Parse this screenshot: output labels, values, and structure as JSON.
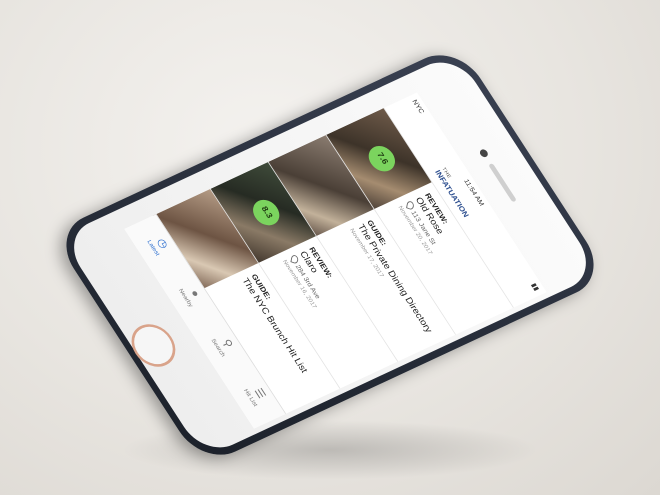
{
  "status": {
    "carrier": "NYC",
    "time": "11:54 AM",
    "battery": ""
  },
  "appbar": {
    "logo_line1": "THE",
    "logo_line2": "INFATUATION"
  },
  "feed": [
    {
      "kind": "REVIEW:",
      "title": "Old Rose",
      "address": "113 Jane St",
      "score": "7.6",
      "date": "November 20, 2017"
    },
    {
      "kind": "GUIDE:",
      "title": "The Private Dining Directory",
      "address": "",
      "score": "",
      "date": "November 17, 2017"
    },
    {
      "kind": "REVIEW:",
      "title": "Claro",
      "address": "284 3rd Ave",
      "score": "8.3",
      "date": "November 16, 2017"
    },
    {
      "kind": "GUIDE:",
      "title": "The NYC Brunch Hit List",
      "address": "",
      "score": "",
      "date": ""
    }
  ],
  "tabs": [
    {
      "label": "Latest",
      "icon": "clock-icon",
      "active": true
    },
    {
      "label": "Nearby",
      "icon": "pin-icon",
      "active": false
    },
    {
      "label": "Search",
      "icon": "search-icon",
      "active": false
    },
    {
      "label": "Hit List",
      "icon": "list-icon",
      "active": false
    }
  ],
  "colors": {
    "score_badge": "#7bd45e",
    "active_tab": "#2d6fd0",
    "logo": "#2c4e8f",
    "case": "#2a3040",
    "home_ring": "#d9a38a"
  }
}
